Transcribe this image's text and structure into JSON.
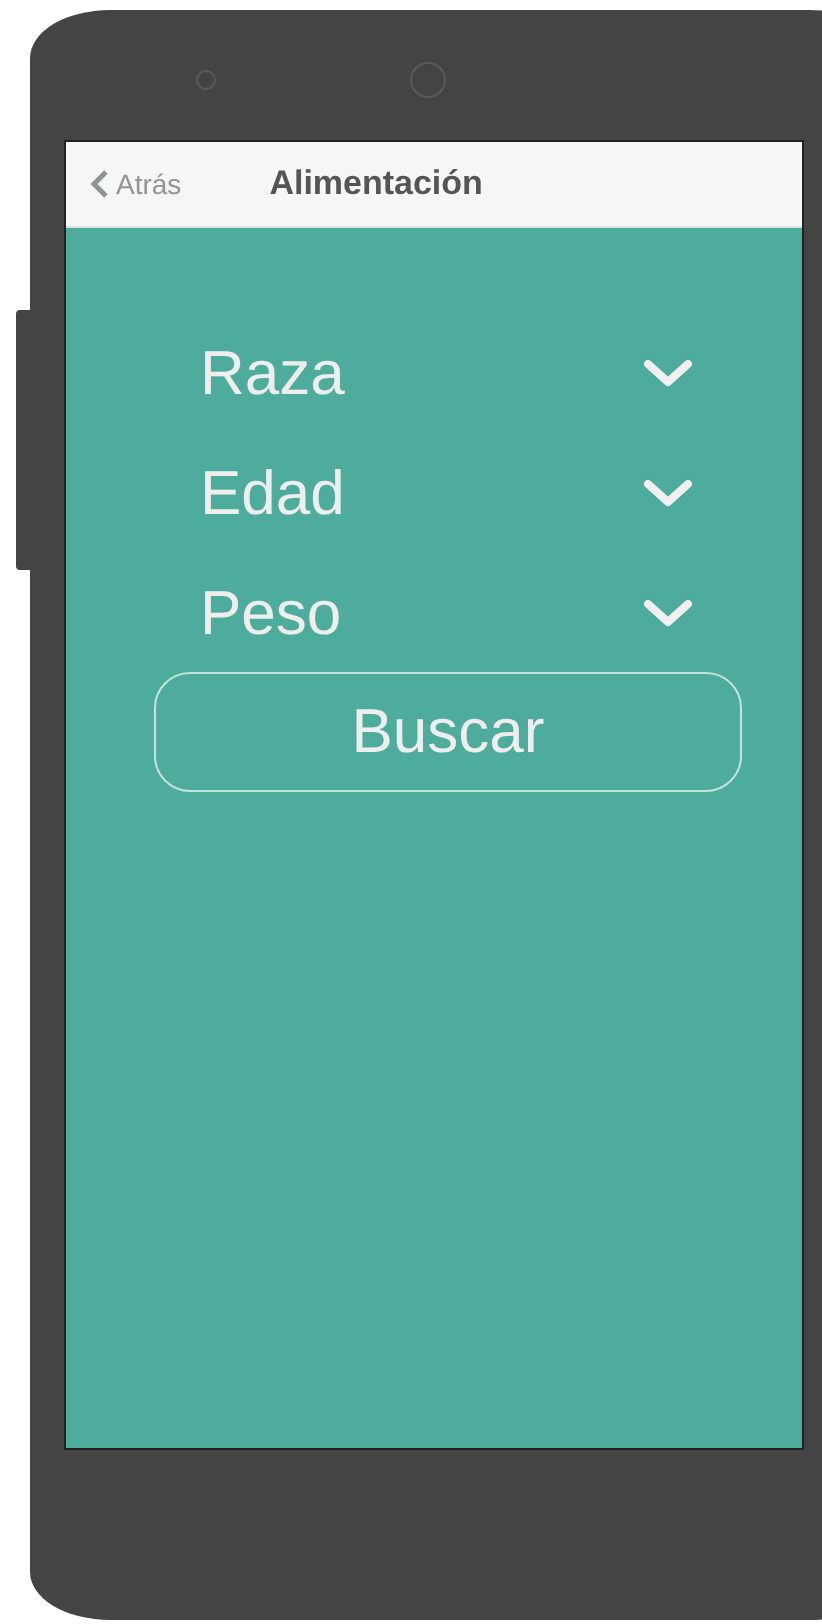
{
  "header": {
    "back": "Atrás",
    "title": "Alimentación"
  },
  "filters": [
    {
      "label": "Raza",
      "expanded": false
    },
    {
      "label": "Edad",
      "expanded": false
    },
    {
      "label": "Peso",
      "expanded": false
    }
  ],
  "search_button": "Buscar"
}
